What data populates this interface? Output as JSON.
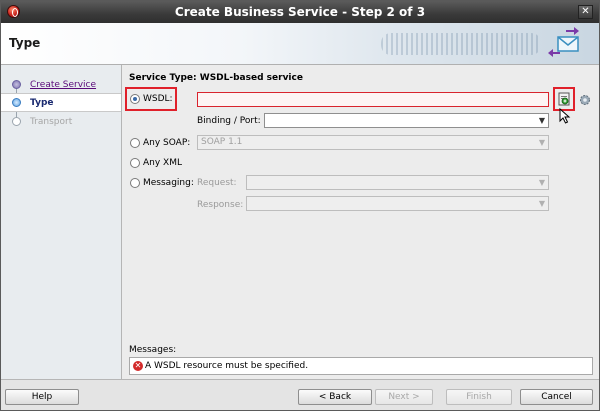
{
  "window": {
    "title": "Create Business Service - Step 2 of 3"
  },
  "header": {
    "title": "Type"
  },
  "nav": {
    "items": [
      {
        "label": "Create Service",
        "state": "done"
      },
      {
        "label": "Type",
        "state": "current"
      },
      {
        "label": "Transport",
        "state": "future"
      }
    ]
  },
  "content": {
    "service_type": "Service Type: WSDL-based service",
    "wsdl": {
      "label": "WSDL:",
      "value": "",
      "selected": true
    },
    "binding": {
      "label": "Binding / Port:",
      "value": ""
    },
    "any_soap": {
      "label": "Any SOAP:",
      "value": "SOAP 1.1"
    },
    "any_xml": {
      "label": "Any XML"
    },
    "messaging": {
      "label": "Messaging:",
      "request_label": "Request:",
      "response_label": "Response:"
    }
  },
  "messages": {
    "label": "Messages:",
    "text": "A WSDL resource must be specified."
  },
  "footer": {
    "help": "Help",
    "back": "< Back",
    "next": "Next >",
    "finish": "Finish",
    "cancel": "Cancel"
  },
  "colors": {
    "highlight_red": "#e0202a",
    "title_bar": "#3a3a3a"
  }
}
